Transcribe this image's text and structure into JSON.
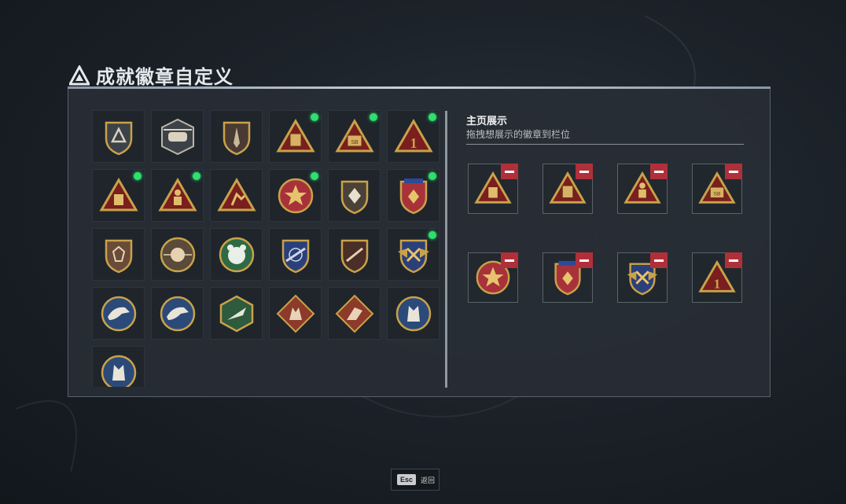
{
  "header": {
    "title": "成就徽章自定义",
    "logo_icon": "triangle-logo-icon"
  },
  "badge_grid": {
    "badges": [
      {
        "icon": "delta-shield-badge-icon",
        "new": false
      },
      {
        "icon": "helicopter-badge-icon",
        "new": false
      },
      {
        "icon": "blade-shield-badge-icon",
        "new": false
      },
      {
        "icon": "backpack-triangle-badge-icon",
        "new": true
      },
      {
        "icon": "sb-crate-triangle-badge-icon",
        "new": true
      },
      {
        "icon": "number-one-triangle-badge-icon",
        "new": true
      },
      {
        "icon": "gold-backpack-triangle-badge-icon",
        "new": true
      },
      {
        "icon": "soldier-triangle-badge-icon",
        "new": true
      },
      {
        "icon": "runner-triangle-badge-icon",
        "new": false
      },
      {
        "icon": "star-medal-badge-icon",
        "new": true
      },
      {
        "icon": "diamond-shield-badge-icon",
        "new": false
      },
      {
        "icon": "blue-star-diamond-shield-badge-icon",
        "new": true
      },
      {
        "icon": "gem-shield-badge-icon",
        "new": false
      },
      {
        "icon": "skull-crosshair-badge-icon",
        "new": false
      },
      {
        "icon": "green-bear-badge-icon",
        "new": false
      },
      {
        "icon": "blue-rifle-shield-badge-icon",
        "new": false
      },
      {
        "icon": "rifle-shield-badge-icon",
        "new": false
      },
      {
        "icon": "winged-cross-shield-badge-icon",
        "new": true
      },
      {
        "icon": "eagle-round-badge-icon",
        "new": false
      },
      {
        "icon": "eagle-round-badge-2-icon",
        "new": false
      },
      {
        "icon": "jet-hexagon-badge-icon",
        "new": false
      },
      {
        "icon": "wolf-diamond-badge-icon",
        "new": false
      },
      {
        "icon": "fighter-diamond-badge-icon",
        "new": false
      },
      {
        "icon": "wolf-round-badge-icon",
        "new": false
      },
      {
        "icon": "wolf-round-badge-2-icon",
        "new": false
      }
    ]
  },
  "showcase": {
    "title": "主页展示",
    "subtitle": "拖拽想展示的徽章到栏位",
    "slots": [
      {
        "icon": "gold-backpack-triangle-badge-icon"
      },
      {
        "icon": "backpack-triangle-badge-icon"
      },
      {
        "icon": "soldier-triangle-badge-icon"
      },
      {
        "icon": "sb-crate-triangle-badge-icon"
      },
      {
        "icon": "star-medal-badge-icon"
      },
      {
        "icon": "blue-star-diamond-shield-badge-icon"
      },
      {
        "icon": "winged-cross-shield-badge-icon"
      },
      {
        "icon": "number-one-triangle-badge-icon"
      }
    ]
  },
  "footer": {
    "esc_key": "Esc",
    "esc_label": "返回"
  },
  "colors": {
    "new_dot": "#2ee06e",
    "remove": "#b0303a",
    "gold": "#c9a24a",
    "crimson": "#7a1e1e"
  }
}
